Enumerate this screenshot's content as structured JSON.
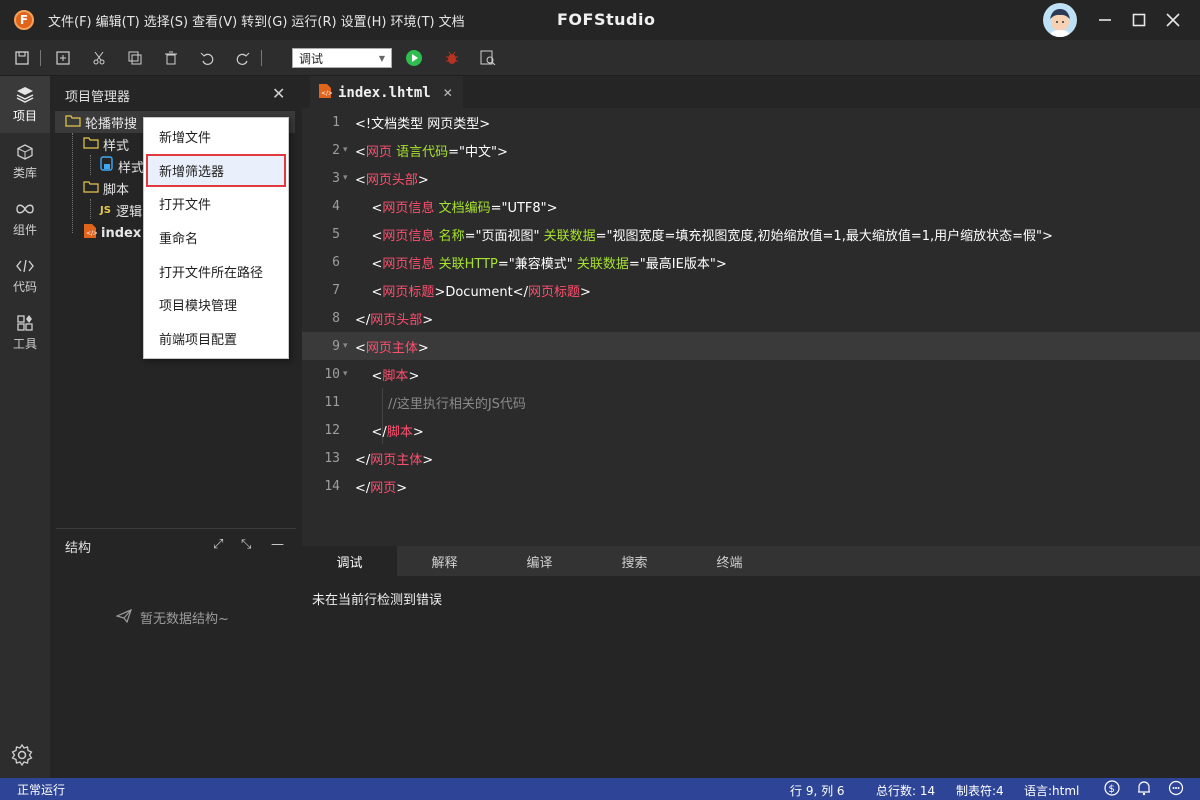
{
  "app": {
    "title": "FOFStudio",
    "menu": [
      "文件(F)",
      "编辑(T)",
      "选择(S)",
      "查看(V)",
      "转到(G)",
      "运行(R)",
      "设置(H)",
      "环境(T)",
      "文档"
    ]
  },
  "toolbar": {
    "mode": "调试"
  },
  "activity": [
    {
      "label": "项目",
      "icon": "layers-icon"
    },
    {
      "label": "类库",
      "icon": "cube-icon"
    },
    {
      "label": "组件",
      "icon": "infinity-icon"
    },
    {
      "label": "代码",
      "icon": "code-icon"
    },
    {
      "label": "工具",
      "icon": "tools-icon"
    }
  ],
  "project_panel": {
    "title": "项目管理器",
    "tree": {
      "root": "轮播带搜",
      "folder_style": "样式",
      "file_style": "样式",
      "folder_script": "脚本",
      "file_script": "逻辑",
      "file_index": "index"
    },
    "structure_title": "结构",
    "structure_empty": "暂无数据结构~"
  },
  "context_menu": {
    "items": [
      "新增文件",
      "新增筛选器",
      "打开文件",
      "重命名",
      "打开文件所在路径",
      "项目模块管理",
      "前端项目配置"
    ],
    "highlighted": "新增筛选器"
  },
  "editor": {
    "tab": "index.lhtml",
    "lines": [
      {
        "n": "1",
        "parts": [
          [
            "t-txt",
            "<!文档类型 网页类型>"
          ]
        ]
      },
      {
        "n": "2",
        "fold": true,
        "parts": [
          [
            "t-txt",
            "<"
          ],
          [
            "t-name",
            "网页"
          ],
          [
            "t-txt",
            " "
          ],
          [
            "t-attr",
            "语言代码"
          ],
          [
            "t-txt",
            "="
          ],
          [
            "t-str",
            "\"中文\""
          ],
          [
            "t-txt",
            ">"
          ]
        ]
      },
      {
        "n": "3",
        "fold": true,
        "parts": [
          [
            "t-txt",
            "<"
          ],
          [
            "t-name",
            "网页头部"
          ],
          [
            "t-txt",
            ">"
          ]
        ]
      },
      {
        "n": "4",
        "parts": [
          [
            "t-txt",
            "    <"
          ],
          [
            "t-name",
            "网页信息"
          ],
          [
            "t-txt",
            " "
          ],
          [
            "t-attr",
            "文档编码"
          ],
          [
            "t-txt",
            "="
          ],
          [
            "t-str",
            "\"UTF8\""
          ],
          [
            "t-txt",
            ">"
          ]
        ]
      },
      {
        "n": "5",
        "parts": [
          [
            "t-txt",
            "    <"
          ],
          [
            "t-name",
            "网页信息"
          ],
          [
            "t-txt",
            " "
          ],
          [
            "t-attr",
            "名称"
          ],
          [
            "t-txt",
            "="
          ],
          [
            "t-str",
            "\"页面视图\""
          ],
          [
            "t-txt",
            " "
          ],
          [
            "t-attr",
            "关联数据"
          ],
          [
            "t-txt",
            "="
          ],
          [
            "t-str",
            "\"视图宽度=填充视图宽度,初始缩放值=1,最大缩放值=1,用户缩放状态=假\""
          ],
          [
            "t-txt",
            ">"
          ]
        ]
      },
      {
        "n": "6",
        "parts": [
          [
            "t-txt",
            "    <"
          ],
          [
            "t-name",
            "网页信息"
          ],
          [
            "t-txt",
            " "
          ],
          [
            "t-attr",
            "关联HTTP"
          ],
          [
            "t-txt",
            "="
          ],
          [
            "t-str",
            "\"兼容模式\""
          ],
          [
            "t-txt",
            " "
          ],
          [
            "t-attr",
            "关联数据"
          ],
          [
            "t-txt",
            "="
          ],
          [
            "t-str",
            "\"最高IE版本\""
          ],
          [
            "t-txt",
            ">"
          ]
        ]
      },
      {
        "n": "7",
        "parts": [
          [
            "t-txt",
            "    <"
          ],
          [
            "t-name",
            "网页标题"
          ],
          [
            "t-txt",
            ">Document</"
          ],
          [
            "t-name",
            "网页标题"
          ],
          [
            "t-txt",
            ">"
          ]
        ]
      },
      {
        "n": "8",
        "parts": [
          [
            "t-txt",
            "</"
          ],
          [
            "t-name",
            "网页头部"
          ],
          [
            "t-txt",
            ">"
          ]
        ]
      },
      {
        "n": "9",
        "fold": true,
        "current": true,
        "parts": [
          [
            "t-txt",
            "<"
          ],
          [
            "t-name",
            "网页主体"
          ],
          [
            "t-txt",
            ">"
          ]
        ]
      },
      {
        "n": "10",
        "fold": true,
        "parts": [
          [
            "t-txt",
            "    <"
          ],
          [
            "t-name",
            "脚本"
          ],
          [
            "t-txt",
            ">"
          ]
        ]
      },
      {
        "n": "11",
        "parts": [
          [
            "t-cmt",
            "        //这里执行相关的JS代码"
          ]
        ]
      },
      {
        "n": "12",
        "parts": [
          [
            "t-txt",
            "    </"
          ],
          [
            "t-name",
            "脚本"
          ],
          [
            "t-txt",
            ">"
          ]
        ]
      },
      {
        "n": "13",
        "parts": [
          [
            "t-txt",
            "</"
          ],
          [
            "t-name",
            "网页主体"
          ],
          [
            "t-txt",
            ">"
          ]
        ]
      },
      {
        "n": "14",
        "parts": [
          [
            "t-txt",
            "</"
          ],
          [
            "t-name",
            "网页"
          ],
          [
            "t-txt",
            ">"
          ]
        ]
      }
    ]
  },
  "bottom_panel": {
    "tabs": [
      "调试",
      "解释",
      "编译",
      "搜索",
      "终端"
    ],
    "active": "调试",
    "message": "未在当前行检测到错误"
  },
  "statusbar": {
    "status": "正常运行",
    "position": "行 9, 列 6",
    "total_lines": "总行数: 14",
    "tab_size": "制表符:4",
    "language": "语言:html"
  },
  "colors": {
    "statusbar": "#2e4597",
    "accent": "#e0641c",
    "tag": "#ff4f6e",
    "attr": "#a6e22e",
    "highlight_border": "#e0393e"
  }
}
